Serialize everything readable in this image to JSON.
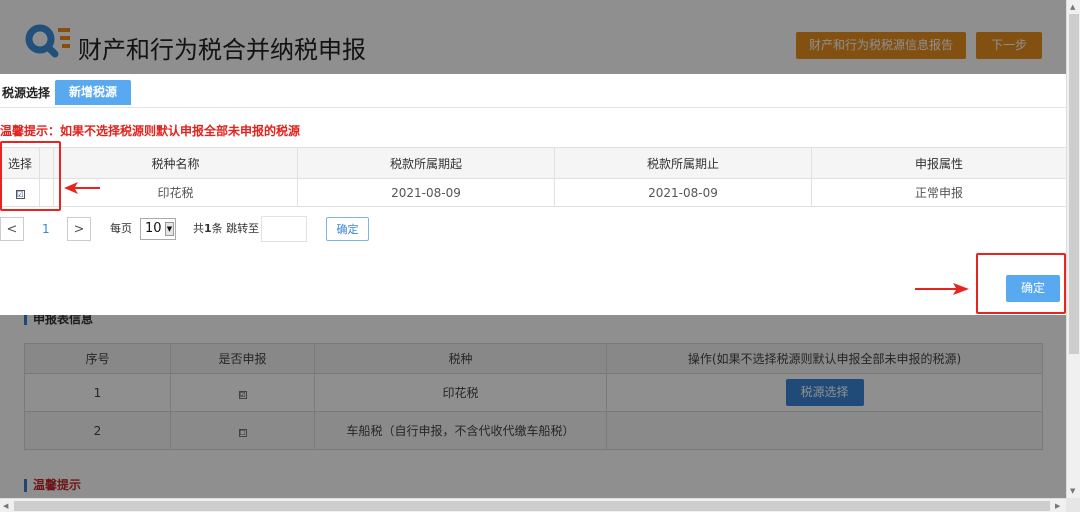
{
  "header": {
    "title": "财产和行为税合并纳税申报",
    "report_button": "财产和行为税税源信息报告",
    "next_button": "下一步"
  },
  "background": {
    "section_declare": "申报表信息",
    "table_headers": [
      "序号",
      "是否申报",
      "税种",
      "操作(如果不选择税源则默认申报全部未申报的税源)"
    ],
    "rows": [
      {
        "no": "1",
        "declare": "☑",
        "tax": "印花税",
        "action": "税源选择"
      },
      {
        "no": "2",
        "declare": "☐",
        "tax": "车船税（自行申报，不含代收代缴车船税）",
        "action": ""
      }
    ],
    "section_warm": "温馨提示"
  },
  "modal": {
    "tab_label": "税源选择",
    "tab_add": "新增税源",
    "warm_tip": "温馨提示：如果不选择税源则默认申报全部未申报的税源",
    "table_headers": [
      "选择",
      "",
      "税种名称",
      "税款所属期起",
      "税款所属期止",
      "申报属性"
    ],
    "rows": [
      {
        "checked": "☑",
        "tax_name": "印花税",
        "period_start": "2021-08-09",
        "period_end": "2021-08-09",
        "attribute": "正常申报"
      }
    ],
    "pagination": {
      "prev": "<",
      "current": "1",
      "next": ">",
      "per_page_label": "每页",
      "page_size": "10",
      "total_prefix": "共",
      "total_count": "1",
      "total_suffix": "条 跳转至",
      "jump_value": "",
      "go_button": "确定"
    },
    "confirm_button": "确定"
  },
  "colors": {
    "accent_blue": "#58a9ef",
    "orange": "#e89020",
    "warning_red": "#e2221d",
    "annotation_red": "#e8241f"
  }
}
